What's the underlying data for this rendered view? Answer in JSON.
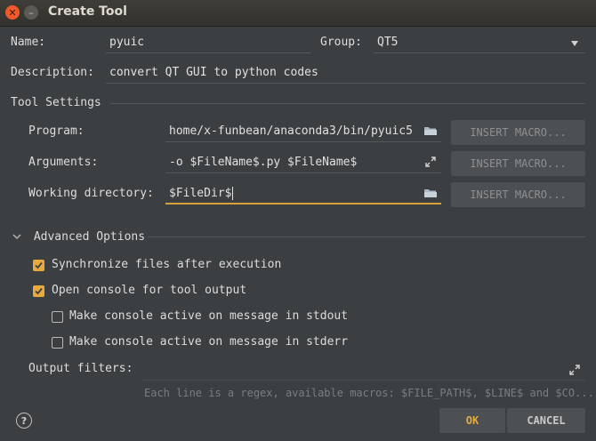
{
  "window": {
    "title": "Create Tool"
  },
  "form": {
    "name_label": "Name:",
    "name_value": "pyuic",
    "group_label": "Group:",
    "group_value": "QT5",
    "description_label": "Description:",
    "description_value": "convert QT GUI to python codes"
  },
  "tool_settings": {
    "heading": "Tool Settings",
    "program_label": "Program:",
    "program_value": "home/x-funbean/anaconda3/bin/pyuic5",
    "arguments_label": "Arguments:",
    "arguments_value": "-o $FileName$.py $FileName$",
    "workdir_label": "Working directory:",
    "workdir_value": "$FileDir$",
    "insert_macro_label": "INSERT MACRO..."
  },
  "advanced": {
    "heading": "Advanced Options",
    "options": [
      {
        "label": "Synchronize files after execution",
        "checked": true
      },
      {
        "label": "Open console for tool output",
        "checked": true
      },
      {
        "label": "Make console active on message in stdout",
        "checked": false
      },
      {
        "label": "Make console active on message in stderr",
        "checked": false
      }
    ],
    "output_filters_label": "Output filters:",
    "output_filters_hint": "Each line is a regex, available macros: $FILE_PATH$, $LINE$ and $CO..."
  },
  "footer": {
    "help_symbol": "?",
    "ok_label": "OK",
    "cancel_label": "CANCEL"
  },
  "colors": {
    "background": "#3c3f41",
    "accent": "#e8a93d",
    "button": "#4c5052",
    "text": "#dcdcdc"
  }
}
